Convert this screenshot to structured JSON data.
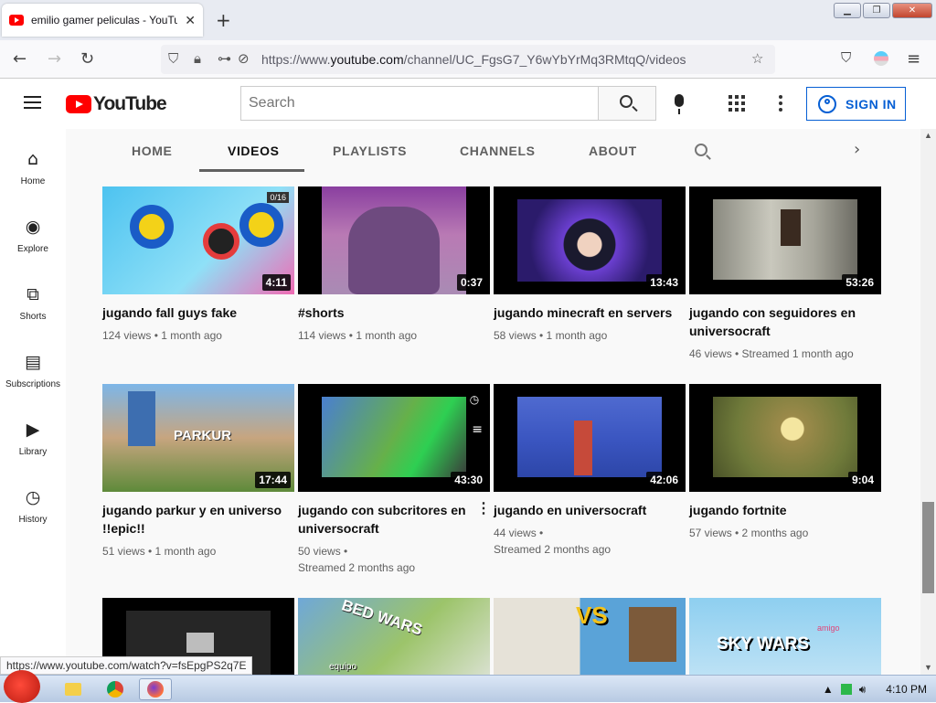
{
  "browser": {
    "tab_title": "emilio gamer peliculas - YouTube",
    "url_prefix": "https://www.",
    "url_domain": "youtube.com",
    "url_path": "/channel/UC_FgsG7_Y6wYbYrMq3RMtqQ/videos",
    "status_url": "https://www.youtube.com/watch?v=fsEpgPS2q7E"
  },
  "youtube": {
    "logo_text": "YouTube",
    "search_placeholder": "Search",
    "signin_label": "SIGN IN"
  },
  "guide": [
    {
      "label": "Home",
      "icon": "home-icon"
    },
    {
      "label": "Explore",
      "icon": "compass-icon"
    },
    {
      "label": "Shorts",
      "icon": "shorts-icon"
    },
    {
      "label": "Subscriptions",
      "icon": "subscriptions-icon"
    },
    {
      "label": "Library",
      "icon": "library-icon"
    },
    {
      "label": "History",
      "icon": "history-icon"
    }
  ],
  "channel_tabs": [
    "HOME",
    "VIDEOS",
    "PLAYLISTS",
    "CHANNELS",
    "ABOUT"
  ],
  "active_tab": "VIDEOS",
  "videos": [
    {
      "title": "jugando fall guys fake",
      "duration": "4:11",
      "meta1": "124 views • 1 month ago",
      "meta2": ""
    },
    {
      "title": "#shorts",
      "duration": "0:37",
      "meta1": "114 views • 1 month ago",
      "meta2": ""
    },
    {
      "title": "jugando minecraft en servers",
      "duration": "13:43",
      "meta1": "58 views • 1 month ago",
      "meta2": ""
    },
    {
      "title": "jugando con seguidores en universocraft",
      "duration": "53:26",
      "meta1": "46 views • Streamed 1 month ago",
      "meta2": ""
    },
    {
      "title": "jugando parkur y en universo !!epic!!",
      "duration": "17:44",
      "meta1": "51 views • 1 month ago",
      "meta2": ""
    },
    {
      "title": "jugando con subcritores en universocraft",
      "duration": "43:30",
      "meta1": "50 views •",
      "meta2": "Streamed 2 months ago"
    },
    {
      "title": "jugando en universocraft",
      "duration": "42:06",
      "meta1": "44 views •",
      "meta2": "Streamed 2 months ago"
    },
    {
      "title": "jugando fortnite",
      "duration": "9:04",
      "meta1": "57 views • 2 months ago",
      "meta2": ""
    }
  ],
  "thumb_texts": {
    "parkur": "PARKUR",
    "bedwars": "BED WARS",
    "vs": "VS",
    "skywars": "SKY WARS",
    "equipo": "equipo",
    "amigo": "amigo",
    "zero": "0/16"
  },
  "taskbar": {
    "clock": "4:10 PM"
  },
  "colors": {
    "brand_red": "#ff0000",
    "link_blue": "#065fd4"
  }
}
